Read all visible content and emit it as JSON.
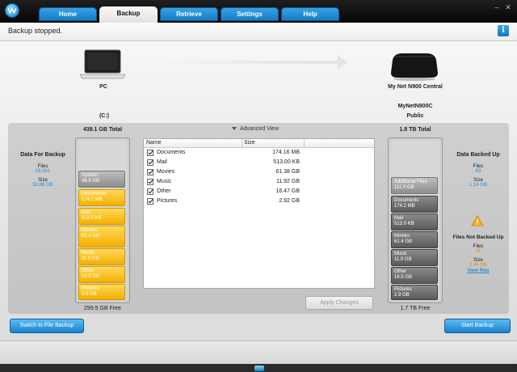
{
  "tabs": [
    "Home",
    "Backup",
    "Retrieve",
    "Settings",
    "Help"
  ],
  "status": {
    "text": "Backup stopped.",
    "info_icon": "i"
  },
  "devices": {
    "source_name": "PC",
    "target_name": "My Net N900 Central",
    "drive_label": "(C:)",
    "target_share_line1": "MyNetN900C",
    "target_share_line2": "Public"
  },
  "source_bar": {
    "total": "439.1 GB Total",
    "free": "299.5 GB Free",
    "segments": [
      {
        "name": "System",
        "size": "46.8 GB",
        "kind": "gray"
      },
      {
        "name": "Documents",
        "size": "174.2 MB",
        "kind": "yellow"
      },
      {
        "name": "Mail",
        "size": "513.0 KB",
        "kind": "yellow"
      },
      {
        "name": "Movies",
        "size": "61.4 GB",
        "kind": "yellow"
      },
      {
        "name": "Music",
        "size": "11.9 GB",
        "kind": "yellow"
      },
      {
        "name": "Other",
        "size": "16.5 GB",
        "kind": "yellow"
      },
      {
        "name": "Pictures",
        "size": "2.9 GB",
        "kind": "yellow"
      }
    ]
  },
  "target_bar": {
    "total": "1.8 TB Total",
    "free": "1.7 TB Free",
    "segments": [
      {
        "name": "Additional Files",
        "size": "111.0 GB",
        "kind": "gray"
      },
      {
        "name": "Documents",
        "size": "174.2 MB",
        "kind": "dark"
      },
      {
        "name": "Mail",
        "size": "513.0 KB",
        "kind": "dark"
      },
      {
        "name": "Movies",
        "size": "61.4 GB",
        "kind": "dark"
      },
      {
        "name": "Music",
        "size": "11.9 GB",
        "kind": "dark"
      },
      {
        "name": "Other",
        "size": "16.5 GB",
        "kind": "dark"
      },
      {
        "name": "Pictures",
        "size": "2.9 GB",
        "kind": "dark"
      }
    ]
  },
  "data_for_backup": {
    "title": "Data For Backup",
    "files_label": "Files",
    "files_value": "16,061",
    "size_label": "Size",
    "size_value": "92.86 GB"
  },
  "data_backed_up": {
    "title": "Data Backed Up",
    "files_label": "Files",
    "files_value": "63",
    "size_label": "Size",
    "size_value": "1.14 GB"
  },
  "files_not_backed_up": {
    "title": "Files Not Backed Up",
    "files_label": "Files",
    "files_value": "31",
    "size_label": "Size",
    "size_value": "3.44 GB",
    "link": "View files"
  },
  "advanced_view": "Advanced View",
  "table": {
    "col_name": "Name",
    "col_size": "Size",
    "rows": [
      {
        "name": "Documents",
        "size": "174.16 MB"
      },
      {
        "name": "Mail",
        "size": "513.00 KB"
      },
      {
        "name": "Movies",
        "size": "61.38 GB"
      },
      {
        "name": "Music",
        "size": "11.92 GB"
      },
      {
        "name": "Other",
        "size": "16.47 GB"
      },
      {
        "name": "Pictures",
        "size": "2.92 GB"
      }
    ]
  },
  "buttons": {
    "apply": "Apply Changes",
    "switch": "Switch to File Backup",
    "start": "Start Backup"
  }
}
